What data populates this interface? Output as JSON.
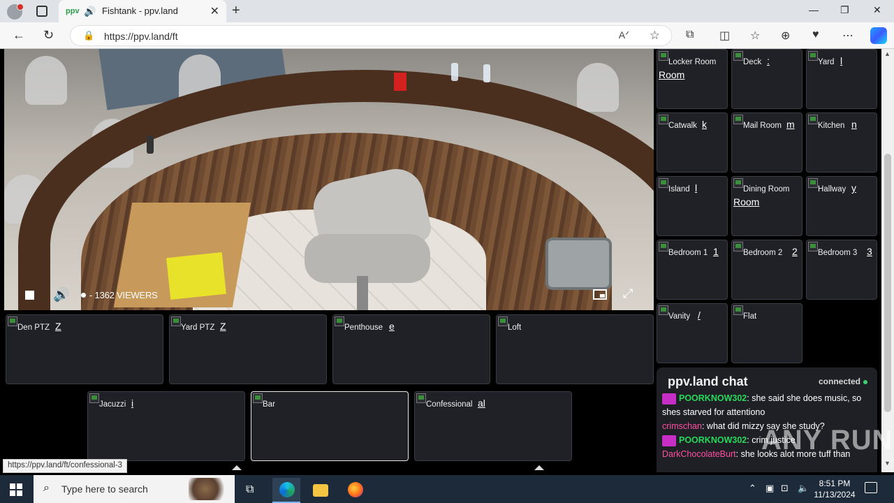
{
  "browser": {
    "tab_title": "Fishtank - ppv.land",
    "tab_favicon": "ppv",
    "url": "https://ppv.land/ft",
    "new_tab": "+",
    "close_tab": "✕",
    "win_minimize": "—",
    "win_maximize": "❐",
    "win_close": "✕"
  },
  "video": {
    "viewers": "- 1362 VIEWERS"
  },
  "cams_bottom": [
    {
      "label": "Den PTZ",
      "ghost": "Z"
    },
    {
      "label": "Yard PTZ",
      "ghost": "Z"
    },
    {
      "label": "Penthouse",
      "ghost": "e"
    },
    {
      "label": "Loft",
      "ghost": ""
    },
    {
      "label": "Jacuzzi",
      "ghost": "i"
    },
    {
      "label": "Bar",
      "ghost": ""
    },
    {
      "label": "Confessional",
      "ghost": "al"
    }
  ],
  "cams_side": [
    {
      "label": "Locker Room",
      "ghost": "",
      "ghost2": "Room"
    },
    {
      "label": "Deck",
      "ghost": ":"
    },
    {
      "label": "Yard",
      "ghost": "l"
    },
    {
      "label": "Catwalk",
      "ghost": "k"
    },
    {
      "label": "Mail Room",
      "ghost": "m"
    },
    {
      "label": "Kitchen",
      "ghost": "n"
    },
    {
      "label": "Island",
      "ghost": "l"
    },
    {
      "label": "Dining Room",
      "ghost": "",
      "ghost2": "Room"
    },
    {
      "label": "Hallway",
      "ghost": "y"
    },
    {
      "label": "Bedroom 1",
      "ghost": "1"
    },
    {
      "label": "Bedroom 2",
      "ghost": "2"
    },
    {
      "label": "Bedroom 3",
      "ghost": "3"
    },
    {
      "label": "Vanity",
      "ghost": "/"
    },
    {
      "label": "Flat",
      "ghost": ""
    }
  ],
  "chat": {
    "title": "ppv.land chat",
    "status": "connected",
    "messages": [
      {
        "user": "POORKNOW302",
        "user_style": "green",
        "badge": true,
        "text": "she said she does music, so shes starved for attentiono"
      },
      {
        "user": "crimschan",
        "user_style": "pink",
        "badge": false,
        "text": "what did mizzy say she study?"
      },
      {
        "user": "POORKNOW302",
        "user_style": "green",
        "badge": true,
        "text": "crim justice"
      },
      {
        "user": "DarkChocolateBurt",
        "user_style": "pink",
        "badge": false,
        "text": "she looks alot more tuff than"
      }
    ]
  },
  "status_link": "https://ppv.land/ft/confessional-3",
  "watermark": "ANY RUN",
  "taskbar": {
    "search_placeholder": "Type here to search",
    "time": "8:51 PM",
    "date": "11/13/2024"
  },
  "colors": {
    "accent_green": "#3fcf6e",
    "username_green": "#28d85a",
    "username_pink": "#ff4fa3",
    "badge_magenta": "#c62ec6",
    "tile_bg": "#1f2126"
  }
}
